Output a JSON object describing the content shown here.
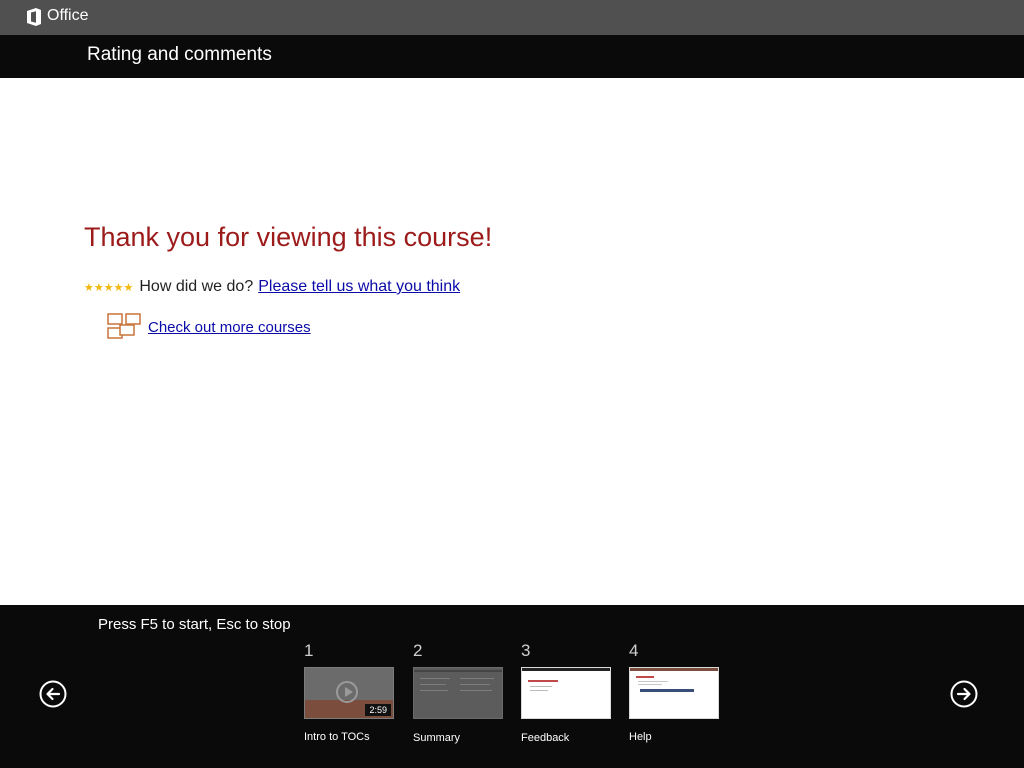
{
  "app": {
    "brand": "Office",
    "title": "Rating and comments"
  },
  "content": {
    "heading": "Thank you for viewing this course!",
    "rating_prompt": "How did we do?",
    "feedback_link": "Please tell us what you think",
    "more_courses_link": "Check out more courses",
    "star_count": 5
  },
  "colors": {
    "heading": "#9c1a1a",
    "link": "#0b0ba8",
    "star": "#f2b70c",
    "nav_bg": "#0a0a0a",
    "office_bar": "#505050"
  },
  "bottom_nav": {
    "hint": "Press F5 to start, Esc to stop",
    "prev_icon": "arrow-left-circle-icon",
    "next_icon": "arrow-right-circle-icon",
    "slides": [
      {
        "number": "1",
        "label": "Intro to TOCs",
        "duration": "2:59"
      },
      {
        "number": "2",
        "label": "Summary"
      },
      {
        "number": "3",
        "label": "Feedback"
      },
      {
        "number": "4",
        "label": "Help"
      }
    ]
  }
}
